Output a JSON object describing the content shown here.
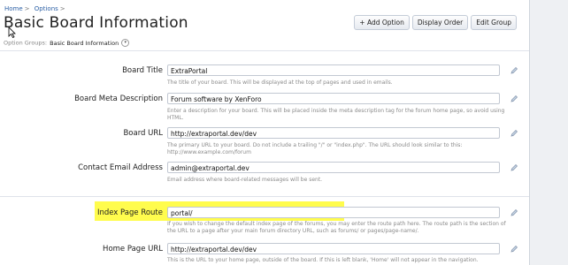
{
  "breadcrumb": {
    "home": "Home",
    "options": "Options"
  },
  "page_title": "Basic Board Information",
  "top_buttons": {
    "add_option": "+ Add Option",
    "display_order": "Display Order",
    "edit_group": "Edit Group"
  },
  "option_groups": {
    "label": "Option Groups:",
    "selected": "Basic Board Information"
  },
  "fields": [
    {
      "label": "Board Title",
      "value": "ExtraPortal",
      "hint": "The title of your board. This will be displayed at the top of pages and used in emails."
    },
    {
      "label": "Board Meta Description",
      "value": "Forum software by XenForo",
      "hint": "Enter a description for your board. This will be placed inside the meta description tag for the forum home page, so avoid using HTML."
    },
    {
      "label": "Board URL",
      "value": "http://extraportal.dev/dev",
      "hint": "The primary URL to your board. Do not include a trailing \"/\" or \"index.php\". The URL should look similar to this: http://www.example.com/forum"
    },
    {
      "label": "Contact Email Address",
      "value": "admin@extraportal.dev",
      "hint": "Email address where board-related messages will be sent."
    },
    {
      "label": "Index Page Route",
      "value": "portal/",
      "hint": "If you wish to change the default index page of the forums, you may enter the route path here. The route path is the section of the URL to a page after your main forum directory URL, such as forums/ or pages/page-name/."
    },
    {
      "label": "Home Page URL",
      "value": "http://extraportal.dev/dev",
      "hint": "This is the URL to your home page, outside of the board. If this is left blank, 'Home' will not appear in the navigation."
    }
  ],
  "colors": {
    "link": "#2b5fa5",
    "highlight": "#fffb2e"
  },
  "icons": {
    "edit": "pencil-icon",
    "dropdown": "chevron-down-icon"
  }
}
